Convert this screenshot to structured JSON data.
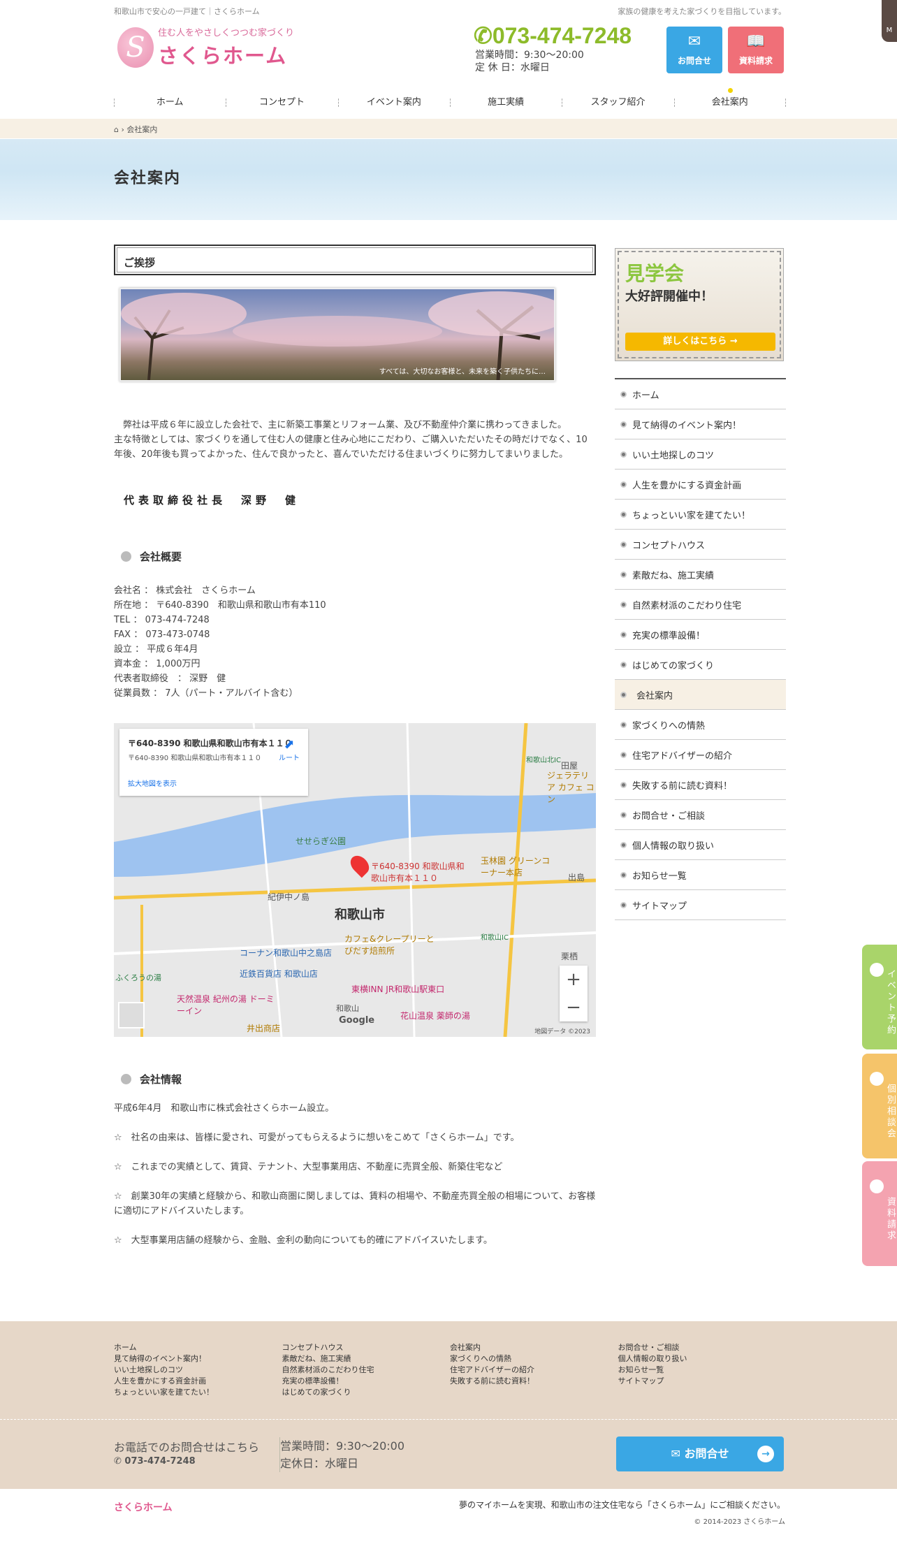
{
  "header": {
    "topline_left": "和歌山市で安心の一戸建て｜さくらホーム",
    "topline_right": "家族の健康を考えた家づくりを目指しています。",
    "logo_tagline": "住む人をやさしくつつむ家づくり",
    "logo_name": "さくらホーム",
    "logo_mark": "S",
    "phone": "073-474-7248",
    "hours_line1": "営業時間：9:30〜20:00",
    "hours_line2": "定 休 日：水曜日",
    "contact_label": "お問合せ",
    "docs_label": "資料請求",
    "corner_label": "M"
  },
  "nav": [
    "ホーム",
    "コンセプト",
    "イベント案内",
    "施工実績",
    "スタッフ紹介",
    "会社案内"
  ],
  "breadcrumb": {
    "current": "会社案内"
  },
  "page_title": "会社案内",
  "greeting": {
    "heading": "ご挨拶",
    "photo_caption": "すべては、大切なお客様と、未来を築く子供たちに…",
    "para1": "　弊社は平成６年に設立した会社で、主に新築工事業とリフォーム業、及び不動産仲介業に携わってきました。",
    "para2": "主な特徴としては、家づくりを通して住む人の健康と住み心地にこだわり、ご購入いただいたその時だけでなく、10年後、20年後も買ってよかった、住んで良かったと、喜んでいただける住まいづくりに努力してまいりました。",
    "signature": "代表取締役社長　深野　健"
  },
  "overview": {
    "heading": "会社概要",
    "lines": [
      "会社名 ： 株式会社　さくらホーム",
      "所在地 ： 〒640-8390　和歌山県和歌山市有本110",
      "TEL ： 073-474-7248",
      "FAX ： 073-473-0748",
      "設立 ： 平成６年4月",
      "資本金 ： 1,000万円",
      "代表者取締役　： 深野　健",
      "従業員数 ： 7人（パート・アルバイト含む）"
    ]
  },
  "map": {
    "card_title": "〒640-8390 和歌山県和歌山市有本１１０",
    "card_sub": "〒640-8390 和歌山県和歌山市有本１１０",
    "card_link": "拡大地図を表示",
    "card_route": "ルート",
    "pin_label": "〒640-8390 和歌山県和歌山市有本１１０",
    "city": "和歌山市",
    "places": [
      "せせらぎ公園",
      "紀伊中ノ島",
      "玉林園 グリーンコーナー本店",
      "コーナン和歌山中之島店",
      "近鉄百貨店 和歌山店",
      "東横INN JR和歌山駅東口",
      "天然温泉 紀州の湯 ドーミーイン",
      "花山温泉 薬師の湯",
      "カフェ&クレープリーとびだす焙煎所",
      "井出商店",
      "田屋",
      "ジェラテリア カフェ コン",
      "出島",
      "栗栖",
      "和歌山北IC",
      "和歌山IC",
      "和歌山",
      "ふくろうの湯"
    ],
    "google": "Google",
    "zoom_in": "+",
    "zoom_out": "−",
    "copyright": "地図データ ©2023"
  },
  "company_info": {
    "heading": "会社情報",
    "paras": [
      "平成6年4月　和歌山市に株式会社さくらホーム設立。",
      "☆　社名の由来は、皆様に愛され、可愛がってもらえるように想いをこめて「さくらホーム」です。",
      "☆　これまでの実績として、賃貸、テナント、大型事業用店、不動産に売買全般、新築住宅など",
      "☆　創業30年の実績と経験から、和歌山商圏に関しましては、賃料の相場や、不動産売買全般の相場について、お客様に適切にアドバイスいたします。",
      "☆　大型事業用店舗の経験から、金融、金利の動向についても的確にアドバイスいたします。"
    ]
  },
  "sidebar": {
    "banner_title": "見学会",
    "banner_sub": "大好評開催中！",
    "banner_button": "詳しくはこちら",
    "menu": [
      "ホーム",
      "見て納得のイベント案内！",
      "いい土地探しのコツ",
      "人生を豊かにする資金計画",
      "ちょっといい家を建てたい！",
      "コンセプトハウス",
      "素敵だね、施工実績",
      "自然素材派のこだわり住宅",
      "充実の標準設備！",
      "はじめての家づくり",
      "会社案内",
      "家づくりへの情熱",
      "住宅アドバイザーの紹介",
      "失敗する前に読む資料！",
      "お問合せ・ご相談",
      "個人情報の取り扱い",
      "お知らせ一覧",
      "サイトマップ"
    ],
    "current": "会社案内"
  },
  "side_tabs": [
    "イベント予約",
    "個別相談会",
    "資料請求"
  ],
  "colors": {
    "tab1": "#a9d46a",
    "tab2": "#f5c46a",
    "tab3": "#f4a3b0"
  },
  "footer": {
    "cols": [
      [
        "ホーム",
        "見て納得のイベント案内！",
        "いい土地探しのコツ",
        "人生を豊かにする資金計画",
        "ちょっといい家を建てたい！"
      ],
      [
        "コンセプトハウス",
        "素敵だね、施工実績",
        "自然素材派のこだわり住宅",
        "充実の標準設備！",
        "はじめての家づくり"
      ],
      [
        "会社案内",
        "家づくりへの情熱",
        "住宅アドバイザーの紹介",
        "失敗する前に読む資料！"
      ],
      [
        "お問合せ・ご相談",
        "個人情報の取り扱い",
        "お知らせ一覧",
        "サイトマップ"
      ]
    ],
    "inquiry": "お電話でのお問合せはこちら",
    "phone": "073-474-7248",
    "hours1": "営業時間：9:30〜20:00",
    "hours2": "定休日：水曜日",
    "contact_button": "お問合せ",
    "brand": "さくらホーム",
    "tagline": "夢のマイホームを実現、和歌山市の注文住宅なら「さくらホーム」にご相談ください。",
    "copyright": "© 2014-2023 さくらホーム"
  }
}
